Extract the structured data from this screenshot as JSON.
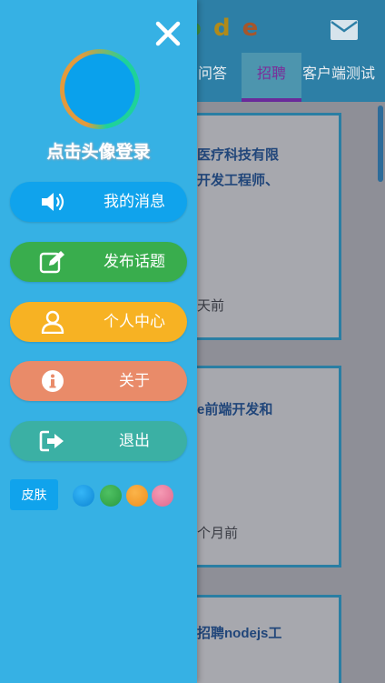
{
  "app": {
    "logo_letters": [
      "o",
      "d",
      "e"
    ],
    "tabs": [
      {
        "label": "问答"
      },
      {
        "label": "招聘"
      },
      {
        "label": "客户端测试"
      }
    ],
    "cards": [
      {
        "title_line1": "医疗科技有限",
        "title_line2": "开发工程师、",
        "time": "天前"
      },
      {
        "title_line1": "e前端开发和",
        "title_line2": "",
        "time": "个月前"
      },
      {
        "title_line1": "招聘nodejs工",
        "title_line2": "",
        "time": ""
      }
    ]
  },
  "drawer": {
    "close_icon": "close-icon",
    "login_text": "点击头像登录",
    "menu": [
      {
        "icon": "volume-icon",
        "label": "我的消息",
        "color": "#10a3ec"
      },
      {
        "icon": "edit-icon",
        "label": "发布话题",
        "color": "#39ad4d"
      },
      {
        "icon": "user-icon",
        "label": "个人中心",
        "color": "#f7b223"
      },
      {
        "icon": "info-icon",
        "label": "关于",
        "color": "#e98b69"
      },
      {
        "icon": "sign-out-icon",
        "label": "退出",
        "color": "#3bb0a4"
      }
    ],
    "skin": {
      "label": "皮肤",
      "swatches": [
        "#10a3ec",
        "#39ad4d",
        "#f7a02a",
        "#ea7fa0"
      ]
    }
  }
}
